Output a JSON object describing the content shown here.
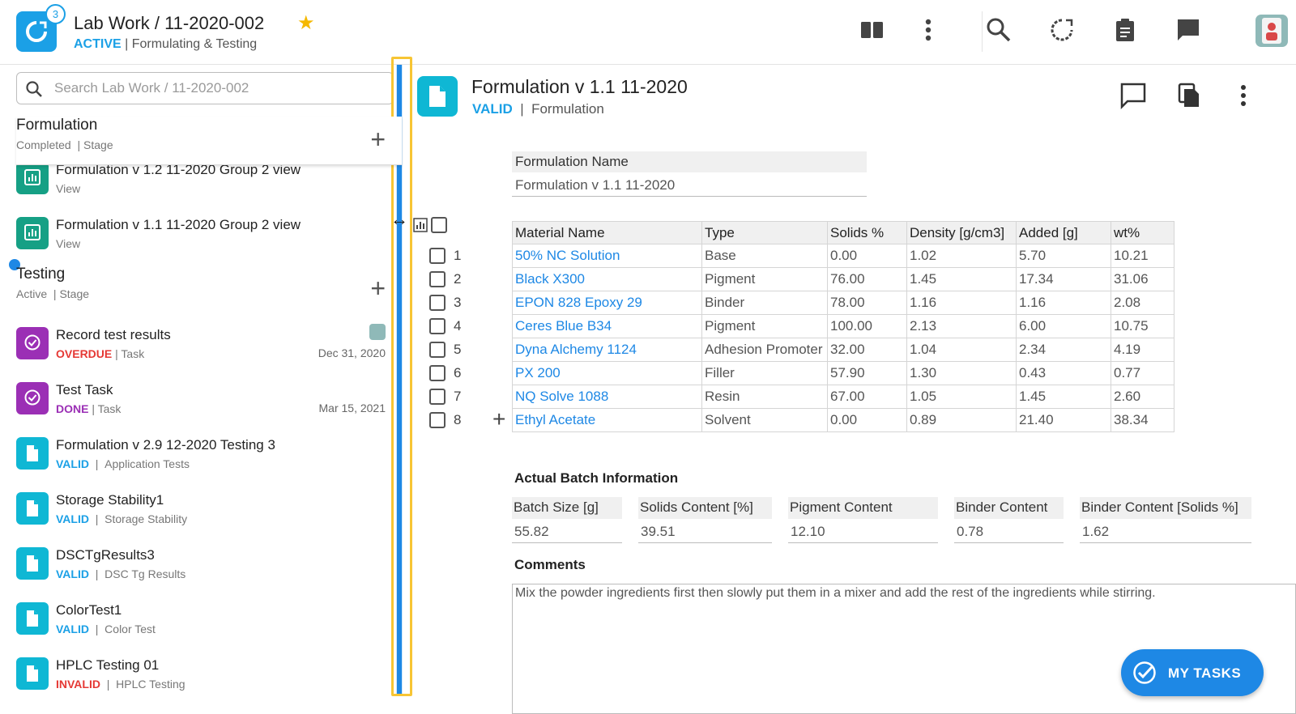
{
  "header": {
    "badge_count": "3",
    "title": "Lab Work / 11-2020-002",
    "status": "ACTIVE",
    "subtitle": "Formulating & Testing"
  },
  "sidebar": {
    "search_placeholder": "Search Lab Work / 11-2020-002",
    "formulation_section": {
      "title": "Formulation",
      "status": "Completed",
      "kind": "Stage"
    },
    "formulation_items": [
      {
        "title": "Formulation v 1.2 11-2020 Group 2 view",
        "sub": "View"
      },
      {
        "title": "Formulation v 1.1 11-2020 Group 2 view",
        "sub": "View"
      }
    ],
    "testing_section": {
      "title": "Testing",
      "status": "Active",
      "kind": "Stage"
    },
    "testing_items": [
      {
        "title": "Record test results",
        "status": "OVERDUE",
        "kind": "Task",
        "date": "Dec 31, 2020"
      },
      {
        "title": "Test Task",
        "status": "DONE",
        "kind": "Task",
        "date": "Mar 15, 2021"
      },
      {
        "title": "Formulation v 2.9 12-2020 Testing 3",
        "status": "VALID",
        "kind": "Application Tests"
      },
      {
        "title": "Storage Stability1",
        "status": "VALID",
        "kind": "Storage Stability"
      },
      {
        "title": "DSCTgResults3",
        "status": "VALID",
        "kind": "DSC Tg Results"
      },
      {
        "title": "ColorTest1",
        "status": "VALID",
        "kind": "Color Test"
      },
      {
        "title": "HPLC Testing 01",
        "status": "INVALID",
        "kind": "HPLC Testing"
      }
    ]
  },
  "document": {
    "title": "Formulation v 1.1 11-2020",
    "status": "VALID",
    "kind": "Formulation",
    "formulation_name_label": "Formulation Name",
    "formulation_name_value": "Formulation v 1.1 11-2020"
  },
  "materials": {
    "headers": [
      "Material Name",
      "Type",
      "Solids %",
      "Density [g/cm3]",
      "Added [g]",
      "wt%"
    ],
    "rows": [
      {
        "num": "1",
        "name": "50% NC Solution",
        "type": "Base",
        "solids": "0.00",
        "density": "1.02",
        "added": "5.70",
        "wt": "10.21"
      },
      {
        "num": "2",
        "name": "Black X300",
        "type": "Pigment",
        "solids": "76.00",
        "density": "1.45",
        "added": "17.34",
        "wt": "31.06"
      },
      {
        "num": "3",
        "name": "EPON 828 Epoxy 29",
        "type": "Binder",
        "solids": "78.00",
        "density": "1.16",
        "added": "1.16",
        "wt": "2.08"
      },
      {
        "num": "4",
        "name": "Ceres Blue B34",
        "type": "Pigment",
        "solids": "100.00",
        "density": "2.13",
        "added": "6.00",
        "wt": "10.75"
      },
      {
        "num": "5",
        "name": "Dyna Alchemy 1124",
        "type": "Adhesion Promoter",
        "solids": "32.00",
        "density": "1.04",
        "added": "2.34",
        "wt": "4.19"
      },
      {
        "num": "6",
        "name": "PX 200",
        "type": "Filler",
        "solids": "57.90",
        "density": "1.30",
        "added": "0.43",
        "wt": "0.77"
      },
      {
        "num": "7",
        "name": "NQ Solve 1088",
        "type": "Resin",
        "solids": "67.00",
        "density": "1.05",
        "added": "1.45",
        "wt": "2.60"
      },
      {
        "num": "8",
        "name": "Ethyl Acetate",
        "type": "Solvent",
        "solids": "0.00",
        "density": "0.89",
        "added": "21.40",
        "wt": "38.34"
      }
    ]
  },
  "batch": {
    "title": "Actual Batch Information",
    "fields": [
      {
        "label": "Batch Size [g]",
        "value": "55.82"
      },
      {
        "label": "Solids Content [%]",
        "value": "39.51"
      },
      {
        "label": "Pigment Content",
        "value": "12.10"
      },
      {
        "label": "Binder Content",
        "value": "0.78"
      },
      {
        "label": "Binder Content [Solids %]",
        "value": "1.62"
      }
    ]
  },
  "comments": {
    "title": "Comments",
    "text": "Mix the powder ingredients first then slowly put them in a mixer and add the rest of the ingredients while stirring."
  },
  "fab": {
    "label": "MY TASKS"
  },
  "colors": {
    "accent": "#1ba0e6",
    "link": "#1e88e5",
    "overdue": "#e53935",
    "done": "#9b2fb5",
    "star": "#f5b800",
    "highlight": "#f7c534"
  },
  "icons": [
    "app-logo-icon",
    "star-icon",
    "columns-icon",
    "more-vert-icon",
    "search-icon",
    "sync-icon",
    "clipboard-icon",
    "chat-icon",
    "avatar",
    "add-icon",
    "chart-icon",
    "task-check-icon",
    "document-icon",
    "comment-icon",
    "copy-icon",
    "checkbox-icon",
    "resize-cursor-icon",
    "check-circle-icon"
  ]
}
